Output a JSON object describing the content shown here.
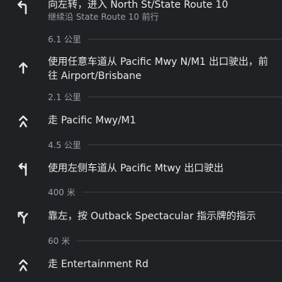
{
  "steps": [
    {
      "icon": "turn-left-icon",
      "instruction": "向左转，进入 North St/State Route 10",
      "sub": "继续沿 State Route 10 前行"
    },
    {
      "icon": "straight-arrow-icon",
      "instruction": "使用任意车道从 Pacific Mwy N/M1 出口驶出，前往 Airport/Brisbane"
    },
    {
      "icon": "merge-icon",
      "instruction": "走 Pacific Mwy/M1"
    },
    {
      "icon": "exit-left-icon",
      "instruction": "使用左侧车道从 Pacific Mtwy 出口驶出"
    },
    {
      "icon": "fork-left-icon",
      "instruction": "靠左，按 Outback Spectacular 指示牌的指示"
    },
    {
      "icon": "merge-icon",
      "instruction": "走 Entertainment Rd"
    }
  ],
  "distances": [
    "6.1 公里",
    "2.1 公里",
    "4.5 公里",
    "400 米",
    "60 米"
  ]
}
